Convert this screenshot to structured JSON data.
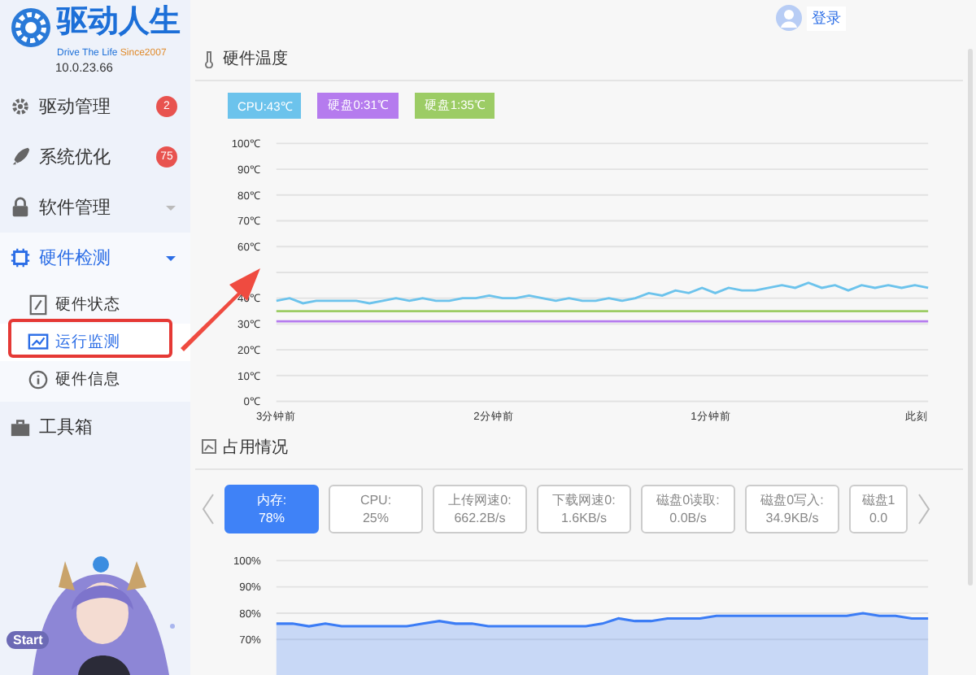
{
  "sidebar": {
    "logo": {
      "title": "驱动人生",
      "slogan": "Drive The Life",
      "since": "Since2007",
      "version": "10.0.23.66"
    },
    "items": [
      {
        "label": "驱动管理",
        "badge": "2",
        "selected": false
      },
      {
        "label": "系统优化",
        "badge": "75",
        "selected": false
      },
      {
        "label": "软件管理",
        "expanded": false,
        "selected": false
      },
      {
        "label": "硬件检测",
        "expanded": true,
        "selected": true,
        "children": [
          {
            "label": "硬件状态",
            "selected": false
          },
          {
            "label": "运行监测",
            "selected": true
          },
          {
            "label": "硬件信息",
            "selected": false
          }
        ]
      },
      {
        "label": "工具箱",
        "selected": false
      }
    ],
    "start_button": "Start"
  },
  "header": {
    "login": "登录"
  },
  "temperature": {
    "title": "硬件温度",
    "chart_data": {
      "type": "line",
      "ylim": [
        0,
        100
      ],
      "grid": true,
      "yticks": [
        {
          "value": 0,
          "label": "0℃"
        },
        {
          "value": 10,
          "label": "10℃"
        },
        {
          "value": 20,
          "label": "20℃"
        },
        {
          "value": 30,
          "label": "30℃"
        },
        {
          "value": 40,
          "label": "40℃"
        },
        {
          "value": 60,
          "label": "60℃"
        },
        {
          "value": 70,
          "label": "70℃"
        },
        {
          "value": 80,
          "label": "80℃"
        },
        {
          "value": 90,
          "label": "90℃"
        },
        {
          "value": 100,
          "label": "100℃"
        }
      ],
      "series": [
        {
          "name": "CPU:43℃",
          "color": "#6cc3ec",
          "values": [
            39,
            40,
            38,
            39,
            39,
            39,
            39,
            38,
            39,
            40,
            39,
            40,
            39,
            39,
            40,
            40,
            41,
            40,
            40,
            41,
            40,
            39,
            40,
            39,
            39,
            40,
            39,
            40,
            42,
            41,
            43,
            42,
            44,
            42,
            44,
            43,
            43,
            44,
            45,
            44,
            46,
            44,
            45,
            43,
            45,
            44,
            45,
            44,
            45,
            44
          ]
        },
        {
          "name": "硬盘0:31℃",
          "color": "#b57bee",
          "values": [
            31,
            31,
            31,
            31,
            31,
            31,
            31,
            31,
            31,
            31,
            31,
            31,
            31,
            31,
            31,
            31,
            31,
            31,
            31,
            31,
            31,
            31,
            31,
            31,
            31,
            31,
            31,
            31,
            31,
            31,
            31,
            31,
            31,
            31,
            31,
            31,
            31,
            31,
            31,
            31,
            31,
            31,
            31,
            31,
            31,
            31,
            31,
            31,
            31,
            31
          ]
        },
        {
          "name": "硬盘1:35℃",
          "color": "#9ccc65",
          "values": [
            35,
            35,
            35,
            35,
            35,
            35,
            35,
            35,
            35,
            35,
            35,
            35,
            35,
            35,
            35,
            35,
            35,
            35,
            35,
            35,
            35,
            35,
            35,
            35,
            35,
            35,
            35,
            35,
            35,
            35,
            35,
            35,
            35,
            35,
            35,
            35,
            35,
            35,
            35,
            35,
            35,
            35,
            35,
            35,
            35,
            35,
            35,
            35,
            35,
            35
          ]
        }
      ]
    },
    "time_labels": [
      "3分钟前",
      "2分钟前",
      "1分钟前",
      "此刻"
    ]
  },
  "usage": {
    "title": "占用情况",
    "cards": [
      {
        "label": "内存:",
        "value": "78%",
        "selected": true
      },
      {
        "label": "CPU:",
        "value": "25%",
        "selected": false
      },
      {
        "label": "上传网速0:",
        "value": "662.2B/s",
        "selected": false
      },
      {
        "label": "下载网速0:",
        "value": "1.6KB/s",
        "selected": false
      },
      {
        "label": "磁盘0读取:",
        "value": "0.0B/s",
        "selected": false
      },
      {
        "label": "磁盘0写入:",
        "value": "34.9KB/s",
        "selected": false
      },
      {
        "label": "磁盘1",
        "value": "0.0",
        "selected": false
      }
    ],
    "chart_data": {
      "type": "area",
      "ylim": [
        70,
        100
      ],
      "grid": true,
      "yticks": [
        {
          "value": 70,
          "label": "70%"
        },
        {
          "value": 80,
          "label": "80%"
        },
        {
          "value": 90,
          "label": "90%"
        },
        {
          "value": 100,
          "label": "100%"
        }
      ],
      "series": [
        {
          "color": "#3b7cf5",
          "values": [
            76,
            76,
            75,
            76,
            75,
            75,
            75,
            75,
            75,
            76,
            77,
            76,
            76,
            75,
            75,
            75,
            75,
            75,
            75,
            75,
            76,
            78,
            77,
            77,
            78,
            78,
            78,
            79,
            79,
            79,
            79,
            79,
            79,
            79,
            79,
            79,
            80,
            79,
            79,
            78,
            78
          ]
        }
      ]
    }
  }
}
